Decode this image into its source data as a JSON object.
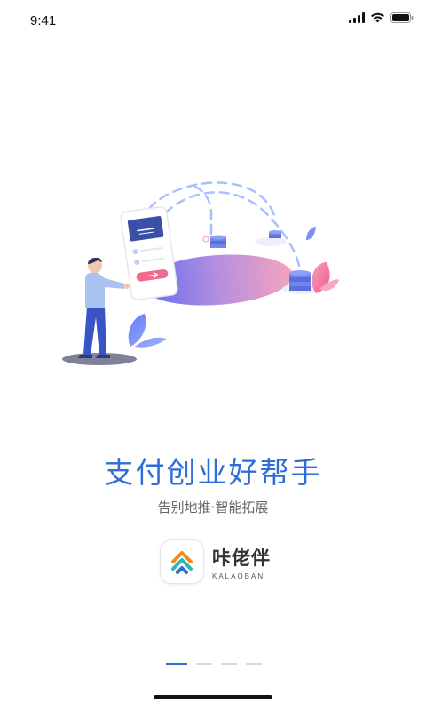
{
  "status_bar": {
    "time": "9:41"
  },
  "content": {
    "headline": "支付创业好帮手",
    "subtitle": "告别地推·智能拓展"
  },
  "brand": {
    "name_cn": "咔佬伴",
    "name_en": "KALAOBAN"
  },
  "pager": {
    "count": 4,
    "active_index": 0
  },
  "colors": {
    "accent": "#2f6ed8",
    "subtitle_gray": "#666666",
    "pink": "#f48fb1",
    "purple_blue": "#6d7ff0"
  }
}
